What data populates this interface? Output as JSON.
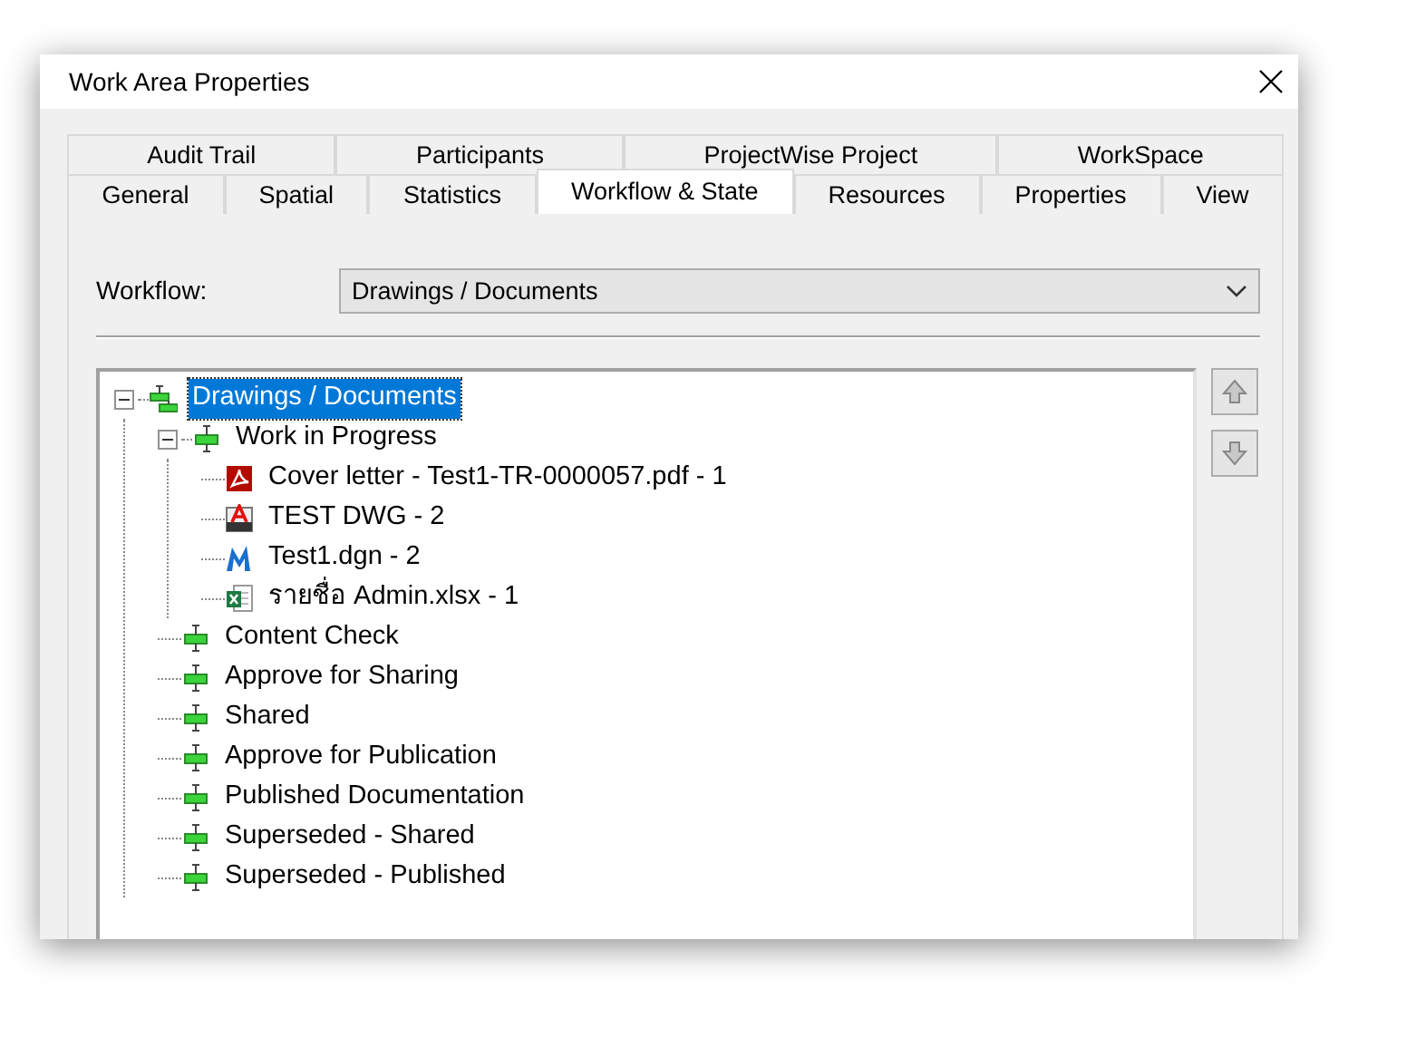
{
  "window": {
    "title": "Work Area Properties"
  },
  "tab_rows": [
    {
      "tabs": [
        {
          "label": "Audit Trail",
          "selected": false
        },
        {
          "label": "Participants",
          "selected": false
        },
        {
          "label": "ProjectWise Project",
          "selected": false
        },
        {
          "label": "WorkSpace",
          "selected": false
        }
      ]
    },
    {
      "tabs": [
        {
          "label": "General",
          "selected": false
        },
        {
          "label": "Spatial",
          "selected": false
        },
        {
          "label": "Statistics",
          "selected": false
        },
        {
          "label": "Workflow & State",
          "selected": true
        },
        {
          "label": "Resources",
          "selected": false
        },
        {
          "label": "Properties",
          "selected": false
        },
        {
          "label": "View",
          "selected": false
        }
      ]
    }
  ],
  "workflow": {
    "label": "Workflow:",
    "value": "Drawings / Documents"
  },
  "tree": [
    {
      "label": "Drawings / Documents",
      "kind": "workflow",
      "selected": true,
      "expanded": true,
      "children": [
        {
          "label": "Work in Progress",
          "kind": "state",
          "selected": false,
          "expanded": true,
          "children": [
            {
              "label": "Cover letter - Test1-TR-0000057.pdf - 1",
              "kind": "pdf",
              "selected": false
            },
            {
              "label": "TEST DWG - 2",
              "kind": "dwg",
              "selected": false
            },
            {
              "label": "Test1.dgn - 2",
              "kind": "dgn",
              "selected": false
            },
            {
              "label": "รายชื่อ Admin.xlsx - 1",
              "kind": "xlsx",
              "selected": false
            }
          ]
        },
        {
          "label": "Content Check",
          "kind": "state",
          "selected": false
        },
        {
          "label": "Approve for Sharing",
          "kind": "state",
          "selected": false
        },
        {
          "label": "Shared",
          "kind": "state",
          "selected": false
        },
        {
          "label": "Approve for Publication",
          "kind": "state",
          "selected": false
        },
        {
          "label": "Published Documentation",
          "kind": "state",
          "selected": false
        },
        {
          "label": "Superseded - Shared",
          "kind": "state",
          "selected": false
        },
        {
          "label": "Superseded - Published",
          "kind": "state",
          "selected": false
        }
      ]
    }
  ],
  "move_buttons": [
    {
      "kind": "up",
      "disabled": true
    },
    {
      "kind": "down",
      "disabled": true
    }
  ]
}
